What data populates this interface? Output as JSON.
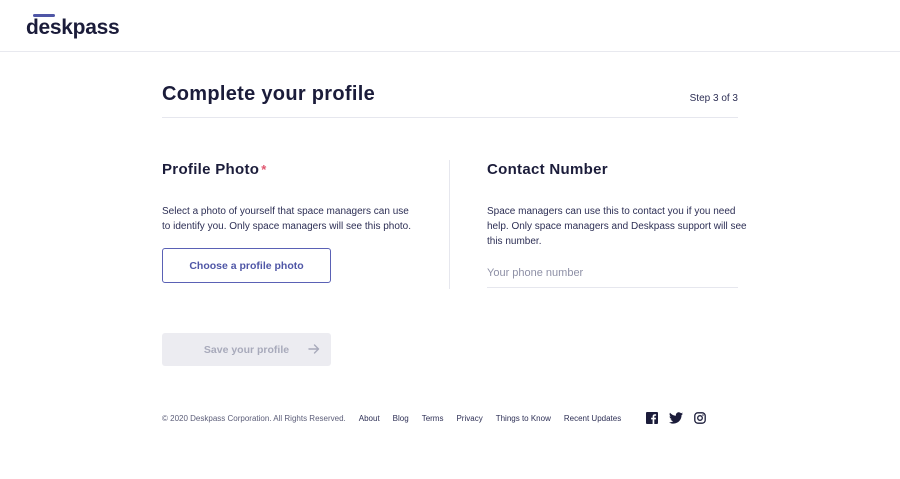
{
  "header": {
    "logo_text": "deskpass"
  },
  "page": {
    "title": "Complete your profile",
    "step": "Step 3 of 3"
  },
  "profile_photo": {
    "title": "Profile Photo",
    "required_mark": "*",
    "description_line1": "Select a photo of yourself that space managers can use",
    "description_line2": "to identify you. Only space managers will see this photo.",
    "button_label": "Choose a profile photo"
  },
  "contact_number": {
    "title": "Contact Number",
    "description_line1": "Space managers can use this to contact you if you need",
    "description_line2": "help. Only space managers and Deskpass support will see",
    "description_line3": "this number.",
    "placeholder": "Your phone number",
    "value": ""
  },
  "actions": {
    "save_label": "Save your profile"
  },
  "footer": {
    "copyright": "© 2020 Deskpass Corporation. All Rights Reserved.",
    "links": [
      "About",
      "Blog",
      "Terms",
      "Privacy",
      "Things to Know",
      "Recent Updates"
    ],
    "social_icons": [
      "facebook-icon",
      "twitter-icon",
      "instagram-icon"
    ]
  },
  "colors": {
    "accent": "#4f56a6",
    "text_dark": "#1b1c3a",
    "required": "#e0566f",
    "disabled_bg": "#ececf1",
    "disabled_text": "#a8aabb"
  }
}
